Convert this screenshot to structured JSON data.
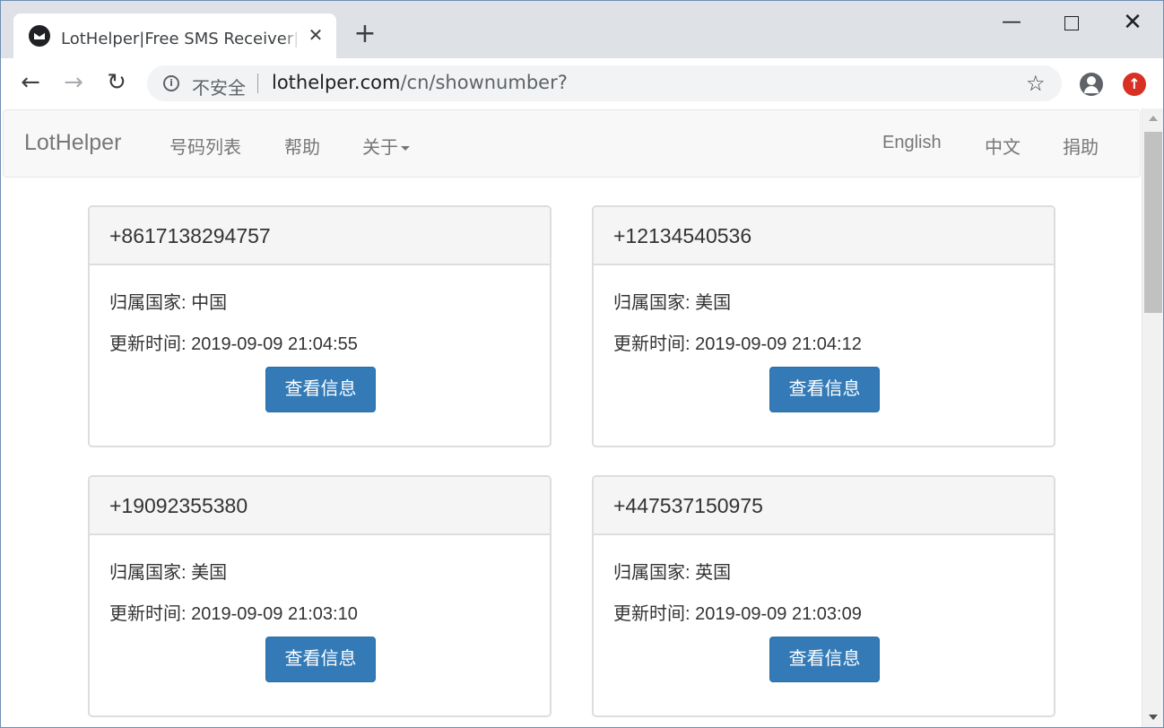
{
  "browser": {
    "tab_title": "LotHelper|Free SMS Receiver|免费短信接收",
    "tab_close": "✕",
    "new_tab": "+",
    "security_label": "不安全",
    "url_host": "lothelper.com",
    "url_path": "/cn/shownumber?",
    "info_glyph": "i"
  },
  "navbar": {
    "brand": "LotHelper",
    "left_links": [
      "号码列表",
      "帮助",
      "关于"
    ],
    "right_links": [
      "English",
      "中文",
      "捐助"
    ]
  },
  "labels": {
    "country_prefix": "归属国家: ",
    "time_prefix": "更新时间: ",
    "view_button": "查看信息"
  },
  "numbers": [
    {
      "phone": "+8617138294757",
      "country": "归属国家: 中国",
      "updated": "更新时间: 2019-09-09 21:04:55",
      "button": "查看信息"
    },
    {
      "phone": "+12134540536",
      "country": "归属国家: 美国",
      "updated": "更新时间: 2019-09-09 21:04:12",
      "button": "查看信息"
    },
    {
      "phone": "+19092355380",
      "country": "归属国家: 美国",
      "updated": "更新时间: 2019-09-09 21:03:10",
      "button": "查看信息"
    },
    {
      "phone": "+447537150975",
      "country": "归属国家: 英国",
      "updated": "更新时间: 2019-09-09 21:03:09",
      "button": "查看信息"
    }
  ],
  "colors": {
    "primary_button": "#337ab7",
    "navbar_bg": "#f8f8f8",
    "panel_heading_bg": "#f5f5f5",
    "update_badge": "#d93025"
  }
}
